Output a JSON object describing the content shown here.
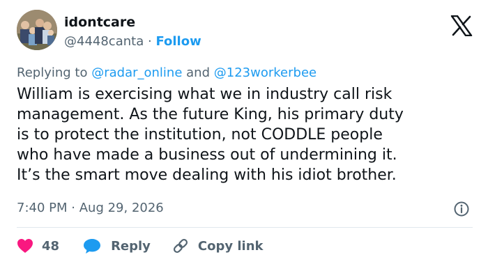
{
  "user": {
    "display_name": "idontcare",
    "handle": "@4448canta",
    "separator": "·",
    "follow_label": "Follow"
  },
  "reply_context": {
    "prefix": "Replying to",
    "mention_1": "@radar_online",
    "conjunction": "and",
    "mention_2": "@123workerbee"
  },
  "tweet": {
    "text": "William is exercising what we in industry call risk\nmanagement. As the future King, his primary duty\nis to protect the institution, not CODDLE people\nwho have made a business out of undermining it.\nIt’s the smart move dealing with his idiot brother."
  },
  "meta": {
    "time": "7:40 PM",
    "separator": "·",
    "date": "Aug 29, 2026"
  },
  "actions": {
    "like_count": "48",
    "reply_label": "Reply",
    "copy_link_label": "Copy link"
  },
  "colors": {
    "accent": "#1d9bf0",
    "like": "#f91880",
    "secondary_text": "#536471",
    "primary_text": "#0f1419"
  },
  "icons": {
    "brand": "x-logo-icon",
    "info": "info-icon",
    "like": "heart-icon",
    "reply": "speech-bubble-icon",
    "copy_link": "link-icon"
  }
}
